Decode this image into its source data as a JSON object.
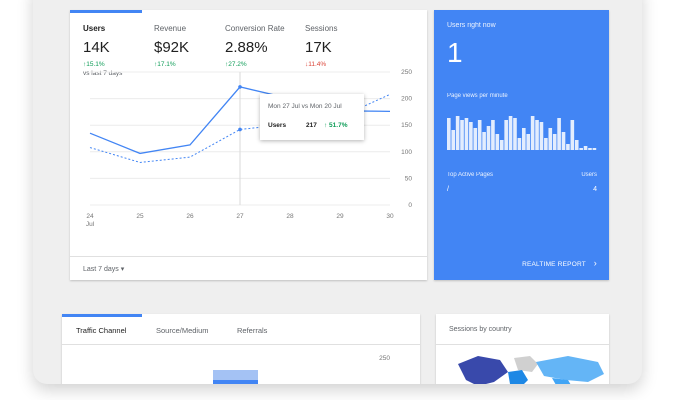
{
  "metrics": [
    {
      "label": "Users",
      "value": "14K",
      "change": "↑15.1%",
      "dir": "up",
      "sub": "vs last 7 days",
      "active": true
    },
    {
      "label": "Revenue",
      "value": "$92K",
      "change": "↑17.1%",
      "dir": "up",
      "sub": "",
      "active": false
    },
    {
      "label": "Conversion Rate",
      "value": "2.88%",
      "change": "↑27.2%",
      "dir": "up",
      "sub": "",
      "active": false
    },
    {
      "label": "Sessions",
      "value": "17K",
      "change": "↓11.4%",
      "dir": "down",
      "sub": "",
      "active": false
    }
  ],
  "chart_data": {
    "type": "line",
    "x": [
      "24",
      "25",
      "26",
      "27",
      "28",
      "29",
      "30"
    ],
    "x_sublabel": "Jul",
    "yticks": [
      "250",
      "200",
      "150",
      "100",
      "50",
      "0"
    ],
    "ylim": [
      0,
      250
    ],
    "series": [
      {
        "name": "current",
        "style": "solid",
        "values": [
          135,
          97,
          113,
          222,
          200,
          177,
          176
        ]
      },
      {
        "name": "previous",
        "style": "dashed",
        "values": [
          108,
          80,
          90,
          142,
          152,
          165,
          208
        ]
      }
    ]
  },
  "tooltip": {
    "title": "Mon 27 Jul vs Mon 20 Jul",
    "metric": "Users",
    "value": "217",
    "change": "↑ 51.7%"
  },
  "date_range": "Last 7 days",
  "realtime": {
    "title": "Users right now",
    "count": "1",
    "pvm_label": "Page views per minute",
    "bars": [
      0.8,
      0.5,
      0.85,
      0.75,
      0.8,
      0.7,
      0.55,
      0.75,
      0.45,
      0.6,
      0.75,
      0.4,
      0.25,
      0.75,
      0.85,
      0.8,
      0.3,
      0.55,
      0.4,
      0.85,
      0.75,
      0.7,
      0.3,
      0.55,
      0.4,
      0.8,
      0.45,
      0.15,
      0.75,
      0.25,
      0.05,
      0.1,
      0.05,
      0.05
    ],
    "pages_header": "Top Active Pages",
    "users_header": "Users",
    "page": "/",
    "page_users": "4",
    "link": "REALTIME REPORT"
  },
  "traffic": {
    "tabs": [
      "Traffic Channel",
      "Source/Medium",
      "Referrals"
    ],
    "ytick": "250"
  },
  "country": {
    "title": "Sessions by country"
  },
  "colors": {
    "accent": "#4285f4",
    "up": "#0f9d58",
    "down": "#db4437"
  }
}
